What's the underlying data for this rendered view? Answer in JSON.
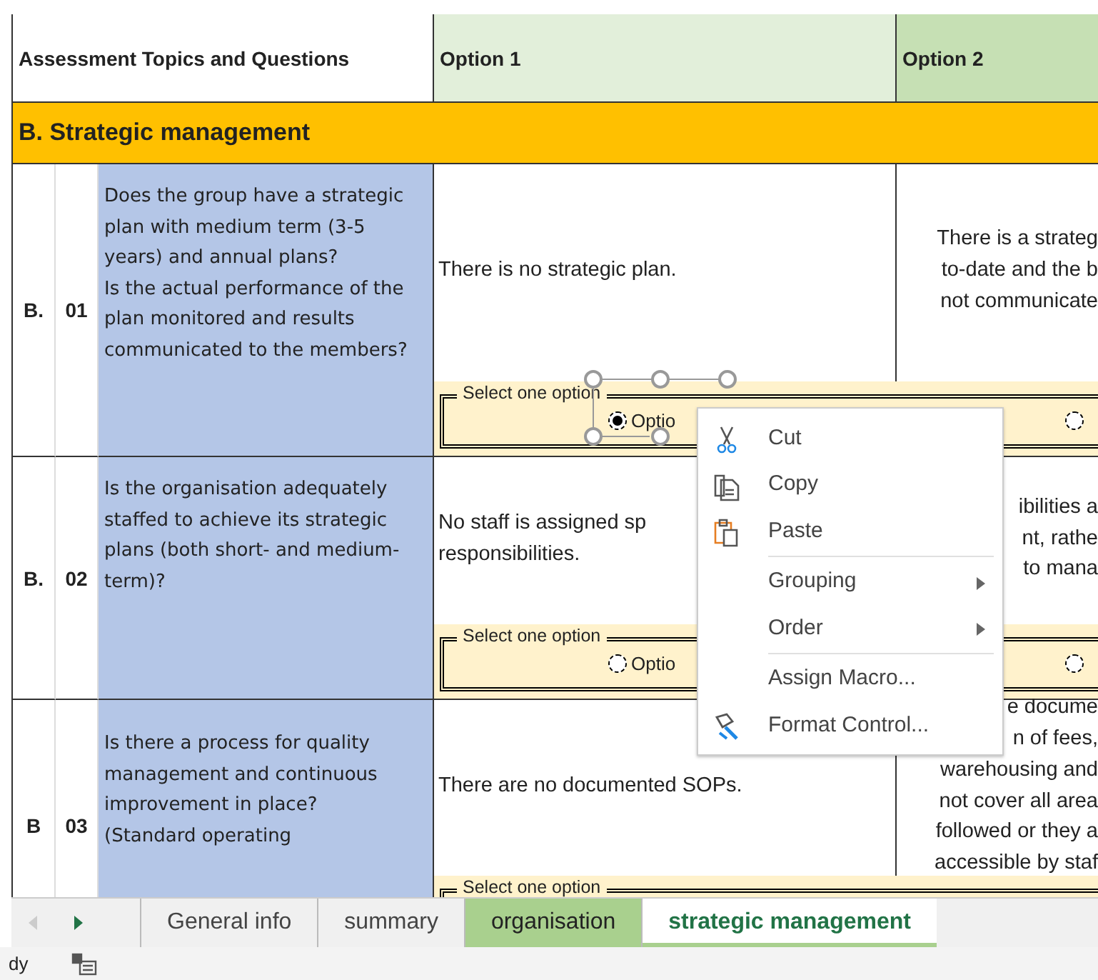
{
  "header": {
    "topics": "Assessment Topics and Questions",
    "columns": [
      "Option 1",
      "Option 2"
    ]
  },
  "section": "B. Strategic management",
  "rows": [
    {
      "letter": "B.",
      "number": "01",
      "question": "Does the group have a strategic plan with medium term (3-5 years) and annual plans?\nIs the actual performance of the plan monitored and results communicated to the members?",
      "option_1": "There is no strategic plan.",
      "option_2": "There is a strateg\nto-date and the b\nnot communicate",
      "group_box": {
        "label": "Select one option",
        "radios": [
          {
            "label": "Optio",
            "selected": true,
            "editing": true
          },
          {
            "selected": false
          }
        ]
      }
    },
    {
      "letter": "B.",
      "number": "02",
      "question": "Is the organisation adequately staffed to achieve its strategic plans (both short- and medium-term)?",
      "option_1": "No staff is assigned sp\nresponsibilities.",
      "option_2": "ibilities a\nnt, rathe\nto mana",
      "group_box": {
        "label": "Select one option",
        "radios": [
          {
            "label": "Optio",
            "selected": false
          },
          {
            "selected": false
          }
        ]
      }
    },
    {
      "letter": "B",
      "number": "03",
      "question": "Is there a process for quality management and continuous improvement in place?\n(Standard operating",
      "option_1": "There are no documented SOPs.",
      "option_2": "e docume\nn of fees,\nwarehousing and\nnot cover all area\nfollowed or they a\naccessible by staf",
      "group_box": {
        "label": "Select one option"
      }
    }
  ],
  "context_menu": [
    {
      "kind": "cut",
      "label": "Cut"
    },
    {
      "kind": "copy",
      "label": "Copy"
    },
    {
      "kind": "paste",
      "label": "Paste"
    },
    {
      "kind": "separator"
    },
    {
      "kind": "submenu",
      "label": "Grouping"
    },
    {
      "kind": "submenu",
      "label": "Order"
    },
    {
      "kind": "separator"
    },
    {
      "kind": "plain",
      "label": "Assign Macro..."
    },
    {
      "kind": "format",
      "label": "Format Control..."
    }
  ],
  "sheet_tabs": [
    {
      "label": "General info",
      "selected": false
    },
    {
      "label": "summary",
      "selected": false
    },
    {
      "label": "organisation",
      "selected": false,
      "color": "#a9d08e"
    },
    {
      "label": "strategic management",
      "selected": true,
      "color": "#a9d08e"
    }
  ],
  "status_bar": {
    "text": "dy"
  }
}
